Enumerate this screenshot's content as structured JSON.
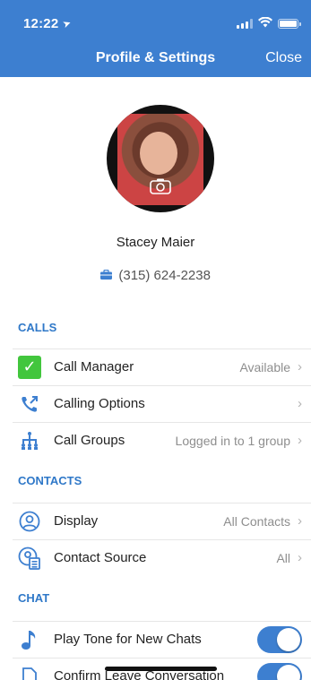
{
  "status_bar": {
    "time": "12:22"
  },
  "header": {
    "title": "Profile & Settings",
    "close_label": "Close"
  },
  "profile": {
    "name": "Stacey Maier",
    "phone": "(315) 624-2238"
  },
  "sections": {
    "calls": {
      "title": "CALLS",
      "items": [
        {
          "label": "Call Manager",
          "value": "Available"
        },
        {
          "label": "Calling Options",
          "value": ""
        },
        {
          "label": "Call Groups",
          "value": "Logged in to 1 group"
        }
      ]
    },
    "contacts": {
      "title": "CONTACTS",
      "items": [
        {
          "label": "Display",
          "value": "All Contacts"
        },
        {
          "label": "Contact Source",
          "value": "All"
        }
      ]
    },
    "chat": {
      "title": "CHAT",
      "items": [
        {
          "label": "Play Tone for New Chats",
          "on": true
        },
        {
          "label": "Confirm Leave Conversation",
          "on": true
        }
      ]
    }
  },
  "colors": {
    "accent": "#3d7fd0",
    "check_green": "#42c63d"
  }
}
